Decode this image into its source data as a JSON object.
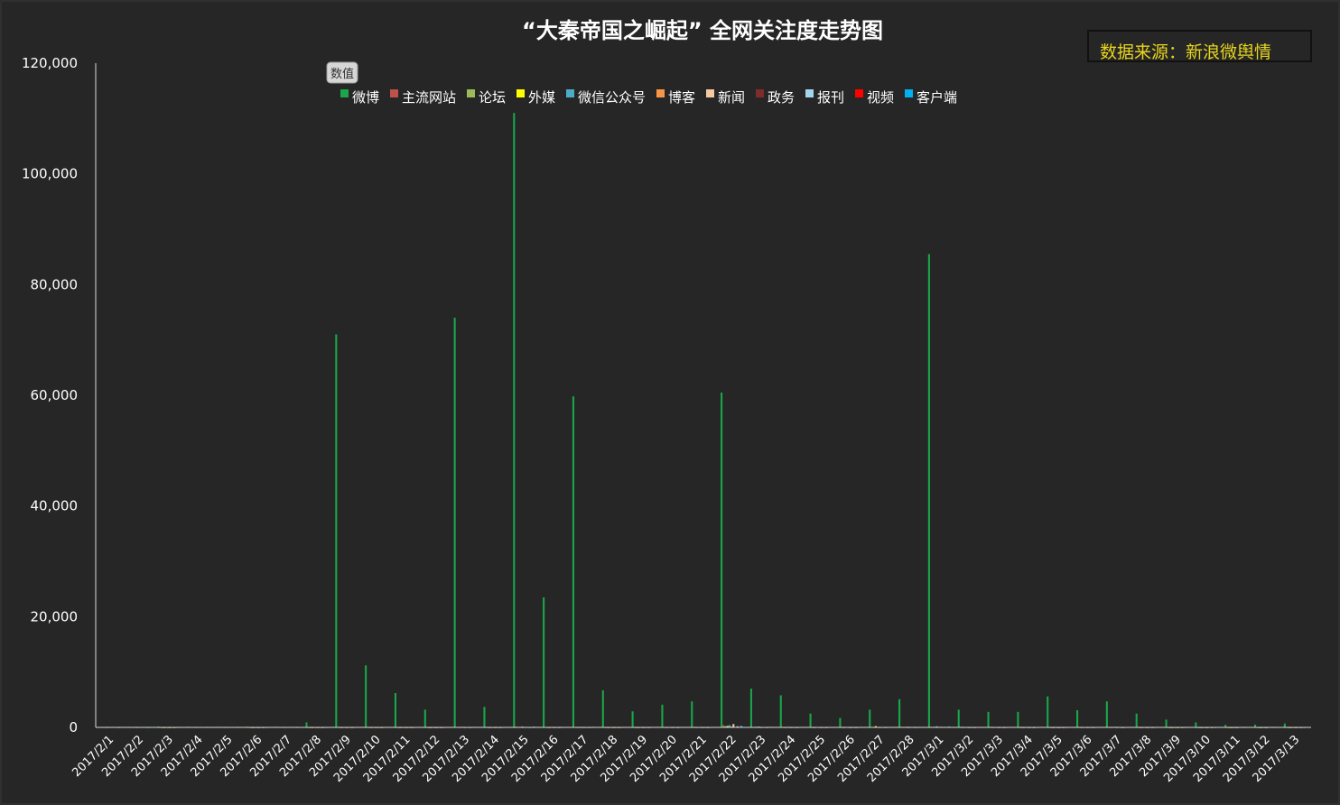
{
  "chart_data": {
    "type": "bar",
    "title": "“大秦帝国之崛起”  全网关注度走势图",
    "source_note": "数据来源：新浪微舆情",
    "value_badge": "数值",
    "ylim": [
      0,
      120000
    ],
    "yticks": [
      "0",
      "20,000",
      "40,000",
      "60,000",
      "80,000",
      "100,000",
      "120,000"
    ],
    "ytick_values": [
      0,
      20000,
      40000,
      60000,
      80000,
      100000,
      120000
    ],
    "legend_position": "top",
    "categories": [
      "2017/2/1",
      "2017/2/2",
      "2017/2/3",
      "2017/2/4",
      "2017/2/5",
      "2017/2/6",
      "2017/2/7",
      "2017/2/8",
      "2017/2/9",
      "2017/2/10",
      "2017/2/11",
      "2017/2/12",
      "2017/2/13",
      "2017/2/14",
      "2017/2/15",
      "2017/2/16",
      "2017/2/17",
      "2017/2/18",
      "2017/2/19",
      "2017/2/20",
      "2017/2/21",
      "2017/2/22",
      "2017/2/23",
      "2017/2/24",
      "2017/2/25",
      "2017/2/26",
      "2017/2/27",
      "2017/2/28",
      "2017/3/1",
      "2017/3/2",
      "2017/3/3",
      "2017/3/4",
      "2017/3/5",
      "2017/3/6",
      "2017/3/7",
      "2017/3/8",
      "2017/3/9",
      "2017/3/10",
      "2017/3/11",
      "2017/3/12",
      "2017/3/13"
    ],
    "series": [
      {
        "name": "微博",
        "color": "#1aa64a",
        "values": [
          80,
          100,
          150,
          120,
          100,
          130,
          110,
          900,
          71000,
          11200,
          6200,
          3200,
          74000,
          3700,
          111000,
          23500,
          59800,
          6700,
          2900,
          4100,
          4700,
          60500,
          7000,
          5800,
          2500,
          1700,
          3200,
          5100,
          85500,
          3200,
          2800,
          2800,
          5600,
          3100,
          4700,
          2500,
          1400,
          900,
          450,
          500,
          700
        ]
      },
      {
        "name": "主流网站",
        "color": "#c0504d",
        "values": [
          0,
          0,
          20,
          0,
          0,
          20,
          0,
          20,
          50,
          30,
          30,
          20,
          80,
          30,
          120,
          50,
          60,
          30,
          20,
          30,
          30,
          400,
          60,
          40,
          20,
          20,
          60,
          80,
          100,
          30,
          30,
          20,
          20,
          30,
          50,
          20,
          10,
          10,
          5,
          5,
          10
        ]
      },
      {
        "name": "论坛",
        "color": "#9bbb59",
        "values": [
          0,
          0,
          10,
          0,
          0,
          10,
          0,
          10,
          20,
          20,
          10,
          10,
          40,
          20,
          40,
          20,
          30,
          20,
          10,
          20,
          20,
          200,
          30,
          20,
          10,
          10,
          40,
          40,
          60,
          20,
          20,
          10,
          10,
          20,
          20,
          10,
          5,
          5,
          5,
          5,
          5
        ]
      },
      {
        "name": "外媒",
        "color": "#ffff00",
        "values": [
          0,
          0,
          5,
          0,
          0,
          5,
          0,
          10,
          20,
          20,
          20,
          10,
          40,
          20,
          60,
          20,
          30,
          20,
          20,
          40,
          40,
          250,
          100,
          40,
          60,
          60,
          220,
          80,
          100,
          40,
          40,
          20,
          10,
          40,
          60,
          20,
          10,
          10,
          5,
          5,
          10
        ]
      },
      {
        "name": "微信公众号",
        "color": "#4bacc6",
        "values": [
          20,
          20,
          30,
          30,
          30,
          20,
          30,
          40,
          60,
          80,
          60,
          40,
          100,
          80,
          150,
          80,
          100,
          80,
          60,
          80,
          80,
          400,
          150,
          100,
          60,
          50,
          100,
          120,
          200,
          80,
          60,
          50,
          30,
          60,
          100,
          50,
          30,
          30,
          20,
          20,
          30
        ]
      },
      {
        "name": "博客",
        "color": "#f79646",
        "values": [
          0,
          0,
          5,
          0,
          0,
          5,
          0,
          10,
          10,
          10,
          10,
          5,
          20,
          10,
          30,
          10,
          20,
          10,
          10,
          10,
          10,
          150,
          20,
          10,
          10,
          10,
          20,
          20,
          40,
          10,
          10,
          10,
          5,
          10,
          10,
          10,
          5,
          5,
          5,
          5,
          5
        ]
      },
      {
        "name": "新闻",
        "color": "#f5c9a0",
        "values": [
          0,
          0,
          10,
          0,
          0,
          10,
          0,
          20,
          30,
          20,
          20,
          10,
          50,
          20,
          80,
          30,
          40,
          20,
          20,
          30,
          30,
          600,
          60,
          30,
          30,
          20,
          80,
          60,
          100,
          30,
          30,
          20,
          10,
          30,
          50,
          20,
          10,
          10,
          5,
          5,
          10
        ]
      },
      {
        "name": "政务",
        "color": "#7f2c2c",
        "values": [
          0,
          0,
          5,
          0,
          0,
          5,
          0,
          5,
          10,
          5,
          5,
          5,
          10,
          5,
          10,
          5,
          10,
          5,
          5,
          5,
          5,
          60,
          10,
          5,
          5,
          5,
          10,
          10,
          20,
          5,
          5,
          5,
          5,
          5,
          5,
          5,
          0,
          0,
          0,
          0,
          0
        ]
      },
      {
        "name": "报刊",
        "color": "#a3d5f0",
        "values": [
          0,
          0,
          5,
          0,
          0,
          5,
          0,
          5,
          10,
          10,
          5,
          5,
          20,
          10,
          30,
          10,
          20,
          10,
          5,
          10,
          10,
          200,
          20,
          10,
          10,
          5,
          20,
          20,
          40,
          10,
          10,
          5,
          5,
          10,
          10,
          5,
          5,
          5,
          0,
          0,
          5
        ]
      },
      {
        "name": "视频",
        "color": "#ff0000",
        "values": [
          0,
          0,
          5,
          0,
          0,
          5,
          0,
          10,
          20,
          10,
          10,
          5,
          40,
          10,
          40,
          20,
          20,
          10,
          10,
          10,
          10,
          200,
          30,
          10,
          10,
          10,
          20,
          30,
          60,
          10,
          10,
          10,
          5,
          10,
          20,
          10,
          5,
          5,
          5,
          5,
          5
        ]
      },
      {
        "name": "客户端",
        "color": "#00b0f0",
        "values": [
          10,
          10,
          20,
          20,
          20,
          20,
          20,
          30,
          60,
          60,
          50,
          30,
          100,
          60,
          150,
          80,
          100,
          60,
          50,
          60,
          60,
          300,
          100,
          80,
          50,
          40,
          80,
          100,
          150,
          60,
          50,
          40,
          30,
          50,
          80,
          40,
          20,
          20,
          20,
          20,
          20
        ]
      }
    ]
  }
}
